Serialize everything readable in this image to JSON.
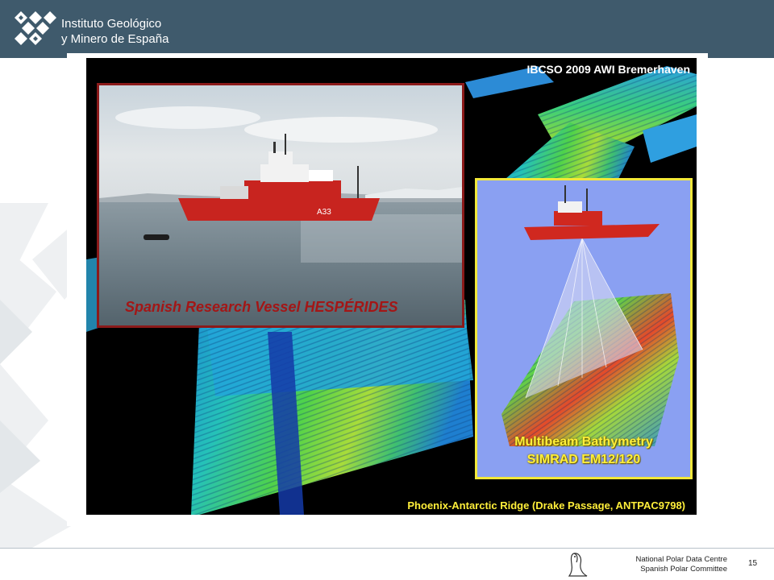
{
  "header": {
    "org_line1": "Instituto Geológico",
    "org_line2": "y Minero de España",
    "logo_icon": "igme-logo"
  },
  "slide": {
    "credit": "IBCSO 2009 AWI Bremerhaven",
    "photo_caption": "Spanish Research Vessel HESPÉRIDES",
    "ship_hull_text": "A33",
    "multibeam_line1": "Multibeam Bathymetry",
    "multibeam_line2": "SIMRAD EM12/120",
    "ridge_caption": "Phoenix-Antarctic Ridge (Drake Passage, ANTPAC9798)"
  },
  "footer": {
    "line1": "National Polar Data Centre",
    "line2": "Spanish Polar Committee",
    "page_number": "15",
    "logo_icon": "penguin-icon"
  },
  "colors": {
    "header_bg": "#3f5a6c",
    "photo_caption": "#a31616",
    "photo_border": "#8b1a1a",
    "multibeam_border": "#f2e83a",
    "caption_yellow": "#ffef3a"
  }
}
